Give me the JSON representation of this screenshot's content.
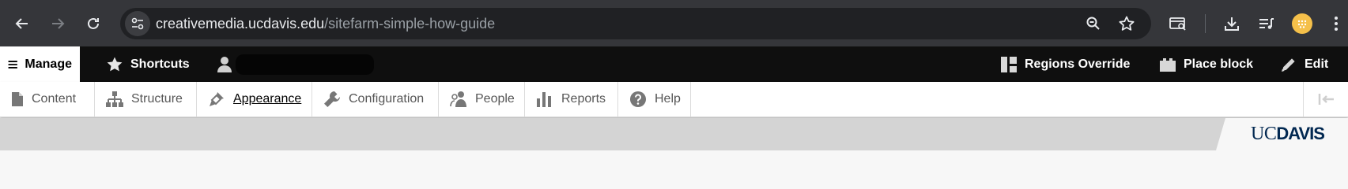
{
  "browser": {
    "url_host": "creativemedia.ucdavis.edu",
    "url_path": "/sitefarm-simple-how-guide",
    "icons": [
      "back-icon",
      "forward-icon",
      "reload-icon",
      "site-info-icon",
      "zoom-icon",
      "star-icon",
      "tab-search-icon",
      "download-icon",
      "reading-list-icon",
      "avatar",
      "more-icon"
    ]
  },
  "admin_bar": {
    "manage": "Manage",
    "shortcuts": "Shortcuts",
    "regions_override": "Regions Override",
    "place_block": "Place block",
    "edit": "Edit"
  },
  "tray": {
    "tabs": [
      {
        "label": "Content",
        "icon": "file-icon"
      },
      {
        "label": "Structure",
        "icon": "sitemap-icon"
      },
      {
        "label": "Appearance",
        "icon": "paintbrush-icon",
        "active": true
      },
      {
        "label": "Configuration",
        "icon": "wrench-icon"
      },
      {
        "label": "People",
        "icon": "people-icon"
      },
      {
        "label": "Reports",
        "icon": "bar-chart-icon"
      },
      {
        "label": "Help",
        "icon": "help-icon"
      }
    ]
  },
  "site_header": {
    "logo_part1": "UC",
    "logo_part2": "DAVIS"
  },
  "colors": {
    "chrome_bg": "#35363a",
    "omnibox_bg": "#202124",
    "admin_bg": "#0f0f0f",
    "logo_navy": "#022851",
    "avatar": "#f5c04a"
  }
}
